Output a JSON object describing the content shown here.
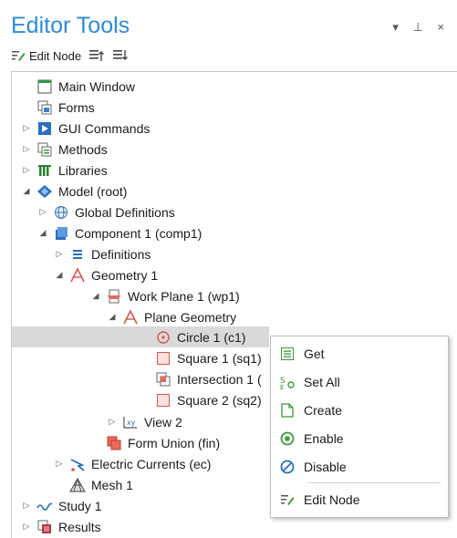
{
  "panel": {
    "title": "Editor Tools",
    "controls": "▾ ⊥ ×"
  },
  "toolbar": {
    "edit_node": "Edit Node"
  },
  "tree": [
    {
      "label": "Main Window",
      "icon": "window-icon"
    },
    {
      "label": "Forms",
      "icon": "forms-icon"
    },
    {
      "label": "GUI Commands",
      "icon": "gui-commands-icon"
    },
    {
      "label": "Methods",
      "icon": "methods-icon"
    },
    {
      "label": "Libraries",
      "icon": "libraries-icon"
    },
    {
      "label": "Model (root)",
      "icon": "model-icon"
    },
    {
      "label": "Global Definitions",
      "icon": "globe-icon"
    },
    {
      "label": "Component 1 (comp1)",
      "icon": "component-icon"
    },
    {
      "label": "Definitions",
      "icon": "definitions-icon"
    },
    {
      "label": "Geometry 1",
      "icon": "geometry-icon"
    },
    {
      "label": "Work Plane 1 (wp1)",
      "icon": "work-plane-icon"
    },
    {
      "label": "Plane Geometry",
      "icon": "plane-geometry-icon"
    },
    {
      "label": "Circle 1 (c1)",
      "icon": "circle-icon"
    },
    {
      "label": "Square 1 (sq1)",
      "icon": "square-icon"
    },
    {
      "label": "Intersection 1 (",
      "icon": "intersection-icon"
    },
    {
      "label": "Square 2 (sq2)",
      "icon": "square-icon"
    },
    {
      "label": "View 2",
      "icon": "view-icon"
    },
    {
      "label": "Form Union (fin)",
      "icon": "form-union-icon"
    },
    {
      "label": "Electric Currents (ec)",
      "icon": "electric-currents-icon"
    },
    {
      "label": "Mesh 1",
      "icon": "mesh-icon"
    },
    {
      "label": "Study 1",
      "icon": "study-icon"
    },
    {
      "label": "Results",
      "icon": "results-icon"
    }
  ],
  "context_menu": [
    {
      "label": "Get",
      "icon": "get-icon"
    },
    {
      "label": "Set All",
      "icon": "set-all-icon"
    },
    {
      "label": "Create",
      "icon": "create-icon"
    },
    {
      "label": "Enable",
      "icon": "enable-icon"
    },
    {
      "label": "Disable",
      "icon": "disable-icon"
    },
    {
      "label": "Edit Node",
      "icon": "edit-node-icon"
    }
  ],
  "colors": {
    "accent": "#2f8cd8",
    "selection": "#d9d9d9"
  }
}
